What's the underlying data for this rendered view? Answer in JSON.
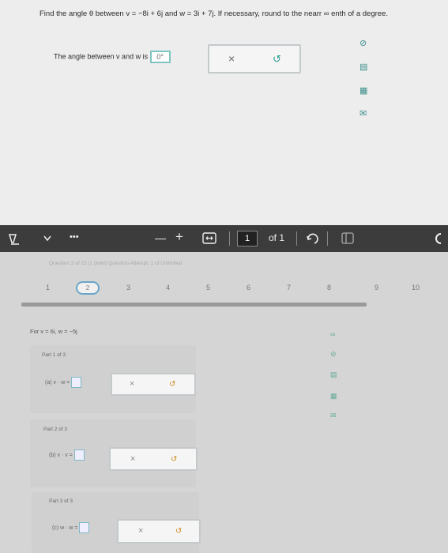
{
  "prev_question": {
    "text": "Find the angle θ between v = −8i + 6j and w = 3i + 7j. If necessary, round to the nearr ∞ enth of a degree.",
    "answer_label": "The angle between v and w is",
    "answer_value": "0°",
    "x_symbol": "×",
    "undo_symbol": "↺"
  },
  "toolbar": {
    "dots": "•••",
    "minus": "—",
    "plus": "+",
    "page_value": "1",
    "of_pages": "of 1"
  },
  "question": {
    "info": "Question 2 of 15 (1 point)   Question Attempt: 1 of Unlimited",
    "numbers": [
      "1",
      "2",
      "3",
      "4",
      "5",
      "6",
      "7",
      "8",
      "9",
      "10"
    ],
    "given": "For v = 6i, w = −5j",
    "parts": [
      {
        "title": "Part 1 of 3",
        "label": "(a) v · w =",
        "x": "×",
        "undo": "↺"
      },
      {
        "title": "Part 2 of 3",
        "label": "(b) v · v =",
        "x": "×",
        "undo": "↺"
      },
      {
        "title": "Part 3 of 3",
        "label": "(c) w · w =",
        "x": "×",
        "undo": "↺"
      }
    ]
  },
  "icons": {
    "infinity": "∞",
    "check": "⊘",
    "doc": "▤",
    "grid": "▦",
    "mail": "✉"
  }
}
